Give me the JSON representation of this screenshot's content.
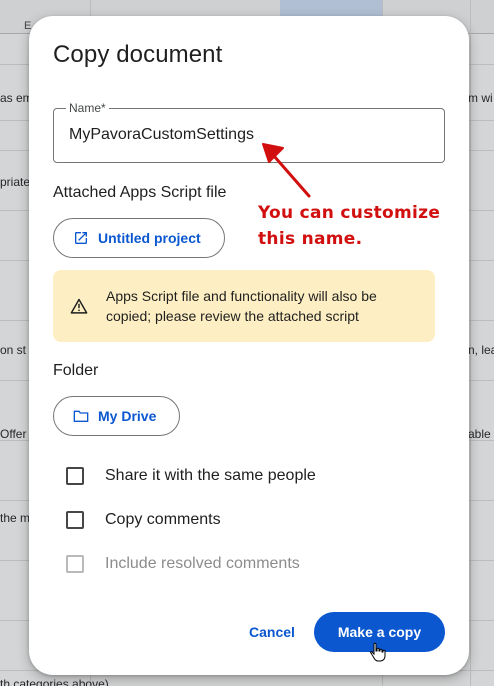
{
  "background": {
    "column_header": "E",
    "fragments": [
      "as em",
      "m wi",
      "priate",
      "on st",
      "n, lea",
      "Offer",
      "able",
      "the m",
      "th categories above)"
    ]
  },
  "dialog": {
    "title": "Copy document",
    "name_field": {
      "label": "Name*",
      "value": "MyPavoraCustomSettings"
    },
    "attached_section": {
      "label": "Attached Apps Script file",
      "project_button": "Untitled project",
      "project_icon": "open-in-new-icon"
    },
    "warning": {
      "icon": "warning-icon",
      "text": "Apps Script file and functionality will also be copied; please review the attached script"
    },
    "folder_section": {
      "label": "Folder",
      "folder_button": "My Drive",
      "folder_icon": "folder-icon"
    },
    "options": [
      {
        "label": "Share it with the same people",
        "checked": false,
        "enabled": true
      },
      {
        "label": "Copy comments",
        "checked": false,
        "enabled": true
      },
      {
        "label": "Include resolved comments",
        "checked": false,
        "enabled": false
      }
    ],
    "buttons": {
      "cancel": "Cancel",
      "make_copy": "Make a copy"
    }
  },
  "annotation": {
    "text_line1": "You can customize",
    "text_line2": "this name.",
    "color": "#d20f0f"
  },
  "colors": {
    "accent": "#0b57d0",
    "warning_bg": "#fdefc3"
  }
}
